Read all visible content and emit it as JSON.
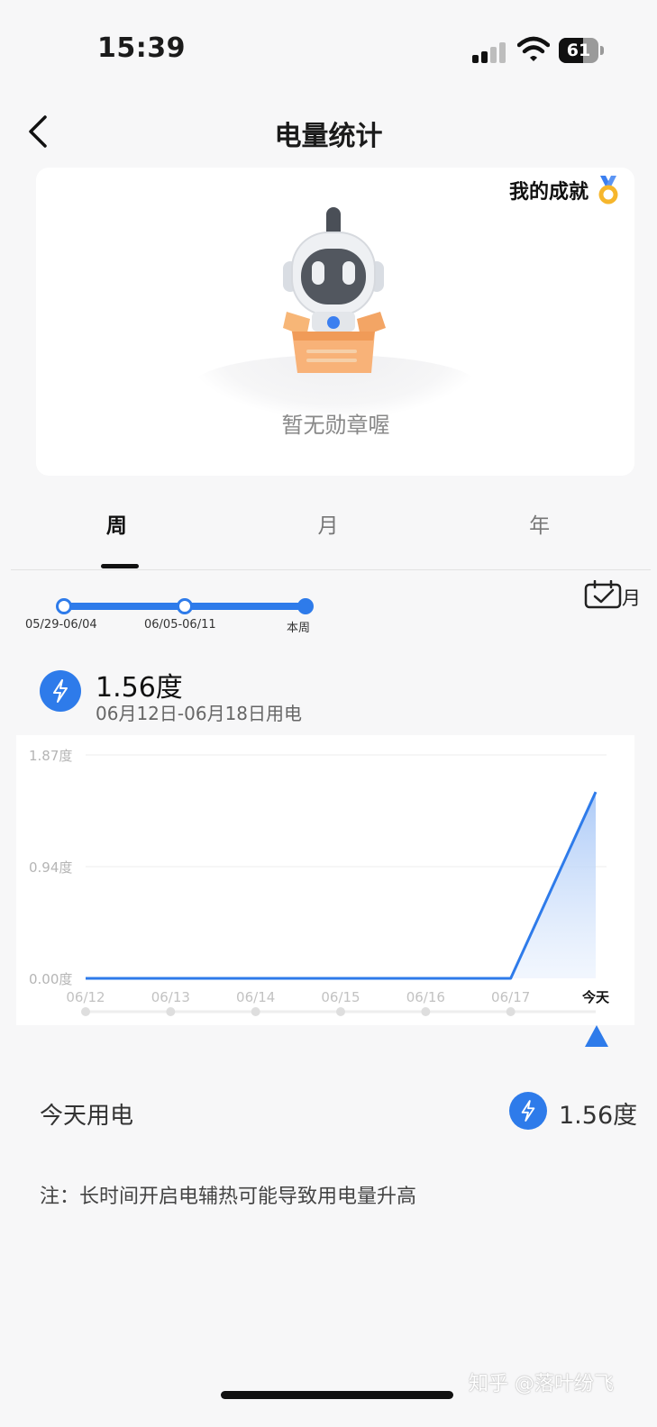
{
  "status": {
    "time": "15:39",
    "battery": "61",
    "battery_level": 0.61
  },
  "nav": {
    "title": "电量统计",
    "back_icon": "chevron-left-icon"
  },
  "achievement": {
    "label": "我的成就",
    "icon": "medal-icon",
    "empty_text": "暂无勋章喔"
  },
  "tabs": [
    {
      "label": "周",
      "active": true
    },
    {
      "label": "月",
      "active": false
    },
    {
      "label": "年",
      "active": false
    }
  ],
  "week_selector": {
    "weeks": [
      "05/29-06/04",
      "06/05-06/11",
      "本周"
    ],
    "current_index": 2,
    "calendar_label": "月"
  },
  "summary": {
    "value": "1.56度",
    "range": "06月12日-06月18日用电",
    "icon": "lightning-icon"
  },
  "chart_data": {
    "type": "area",
    "x": [
      "06/12",
      "06/13",
      "06/14",
      "06/15",
      "06/16",
      "06/17",
      "今天"
    ],
    "values": [
      0,
      0,
      0,
      0,
      0,
      0,
      1.56
    ],
    "yticks": [
      "0.00度",
      "0.94度",
      "1.87度"
    ],
    "ylim": [
      0,
      1.87
    ],
    "grid": true,
    "colors": {
      "line": "#2e7bea",
      "fill": "#bcd5f8"
    }
  },
  "today": {
    "label": "今天用电",
    "value": "1.56度"
  },
  "note": "注：长时间开启电辅热可能导致用电量升高",
  "watermark": "知乎 @落叶纷飞"
}
